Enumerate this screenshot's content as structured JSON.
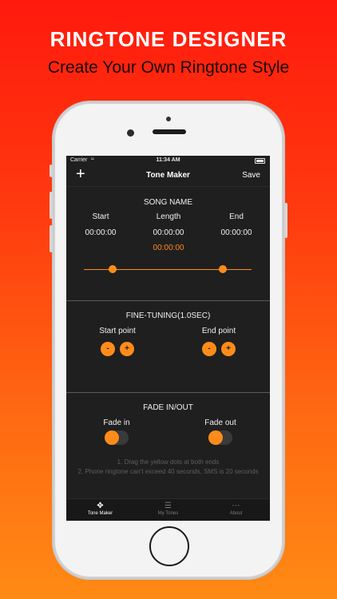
{
  "banner": {
    "headline": "RINGTONE DESIGNER",
    "subhead": "Create Your Own Ringtone Style"
  },
  "status_bar": {
    "carrier": "Carrier",
    "time": "11:34 AM",
    "wifi_icon": "wifi-icon",
    "battery_icon": "battery-icon"
  },
  "nav": {
    "add_icon": "plus-icon",
    "add_glyph": "+",
    "title": "Tone Maker",
    "save_label": "Save"
  },
  "song": {
    "name": "SONG NAME",
    "start_label": "Start",
    "length_label": "Length",
    "end_label": "End",
    "start_value": "00:00:00",
    "length_value": "00:00:00",
    "end_value": "00:00:00",
    "selection_value": "00:00:00",
    "range_start_fraction": 0.17,
    "range_end_fraction": 0.83
  },
  "fine_tuning": {
    "title": "FINE-TUNING(1.0SEC)",
    "start_label": "Start point",
    "end_label": "End point",
    "minus": "-",
    "plus": "+"
  },
  "fade": {
    "title": "FADE IN/OUT",
    "fade_in_label": "Fade in",
    "fade_out_label": "Fade out",
    "fade_in_on": false,
    "fade_out_on": false
  },
  "notes": {
    "line1": "1. Drag the yellow dots at both ends",
    "line2": "2. Phone ringtone can't exceed 40 seconds, SMS is 20 seconds"
  },
  "tabs": [
    {
      "label": "Tone Maker",
      "icon": "tone-maker-icon",
      "active": true
    },
    {
      "label": "My Tones",
      "icon": "list-icon",
      "active": false
    },
    {
      "label": "About",
      "icon": "more-icon",
      "active": false
    }
  ],
  "colors": {
    "accent": "#ff8c1a",
    "screen_bg": "#1f1f1f",
    "banner_top": "#ff1a0d",
    "banner_bottom": "#ff8a15"
  }
}
